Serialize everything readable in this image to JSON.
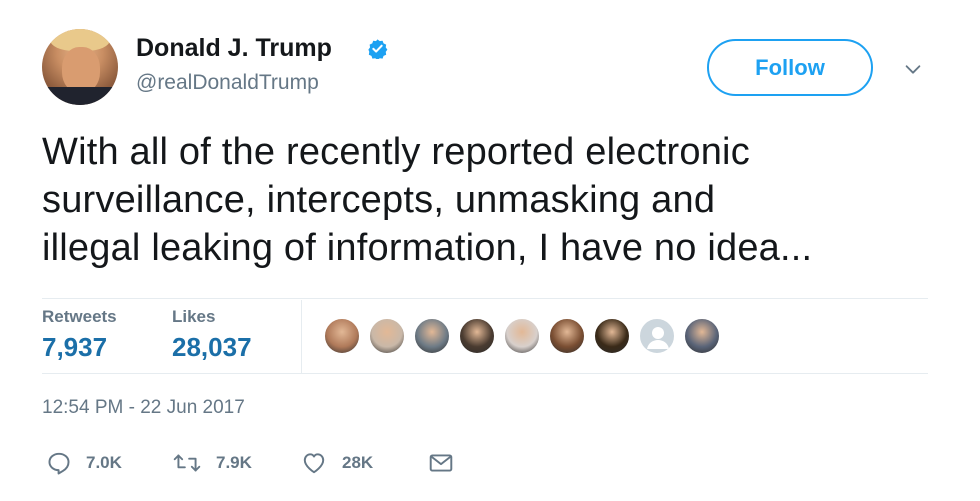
{
  "author": {
    "name": "Donald J. Trump",
    "handle": "@realDonaldTrump",
    "verified": true
  },
  "follow_label": "Follow",
  "tweet": {
    "lines": [
      "With all of the recently reported electronic",
      "surveillance, intercepts, unmasking and",
      "illegal leaking of information, I have no idea..."
    ]
  },
  "stats": {
    "retweets_label": "Retweets",
    "retweets_value": "7,937",
    "likes_label": "Likes",
    "likes_value": "28,037"
  },
  "likers": [
    {
      "icon": "liker-avatar-1",
      "color": "#b07a5a"
    },
    {
      "icon": "liker-avatar-2",
      "color": "#c9b8a8"
    },
    {
      "icon": "liker-avatar-3",
      "color": "#6e7b86"
    },
    {
      "icon": "liker-avatar-4",
      "color": "#4a3b30"
    },
    {
      "icon": "liker-avatar-5",
      "color": "#d8d0cc"
    },
    {
      "icon": "liker-avatar-6",
      "color": "#7a4e32"
    },
    {
      "icon": "liker-avatar-7",
      "color": "#3a2a18"
    },
    {
      "icon": "default-avatar-icon",
      "color": "#aab8c2"
    },
    {
      "icon": "liker-avatar-9",
      "color": "#5a6478"
    }
  ],
  "timestamp": "12:54 PM - 22 Jun 2017",
  "actions": {
    "reply_count": "7.0K",
    "retweet_count": "7.9K",
    "like_count": "28K"
  },
  "colors": {
    "accent": "#1da1f2",
    "stat_value": "#1b6fa8",
    "secondary_text": "#657786",
    "divider": "#e6ecf0"
  }
}
